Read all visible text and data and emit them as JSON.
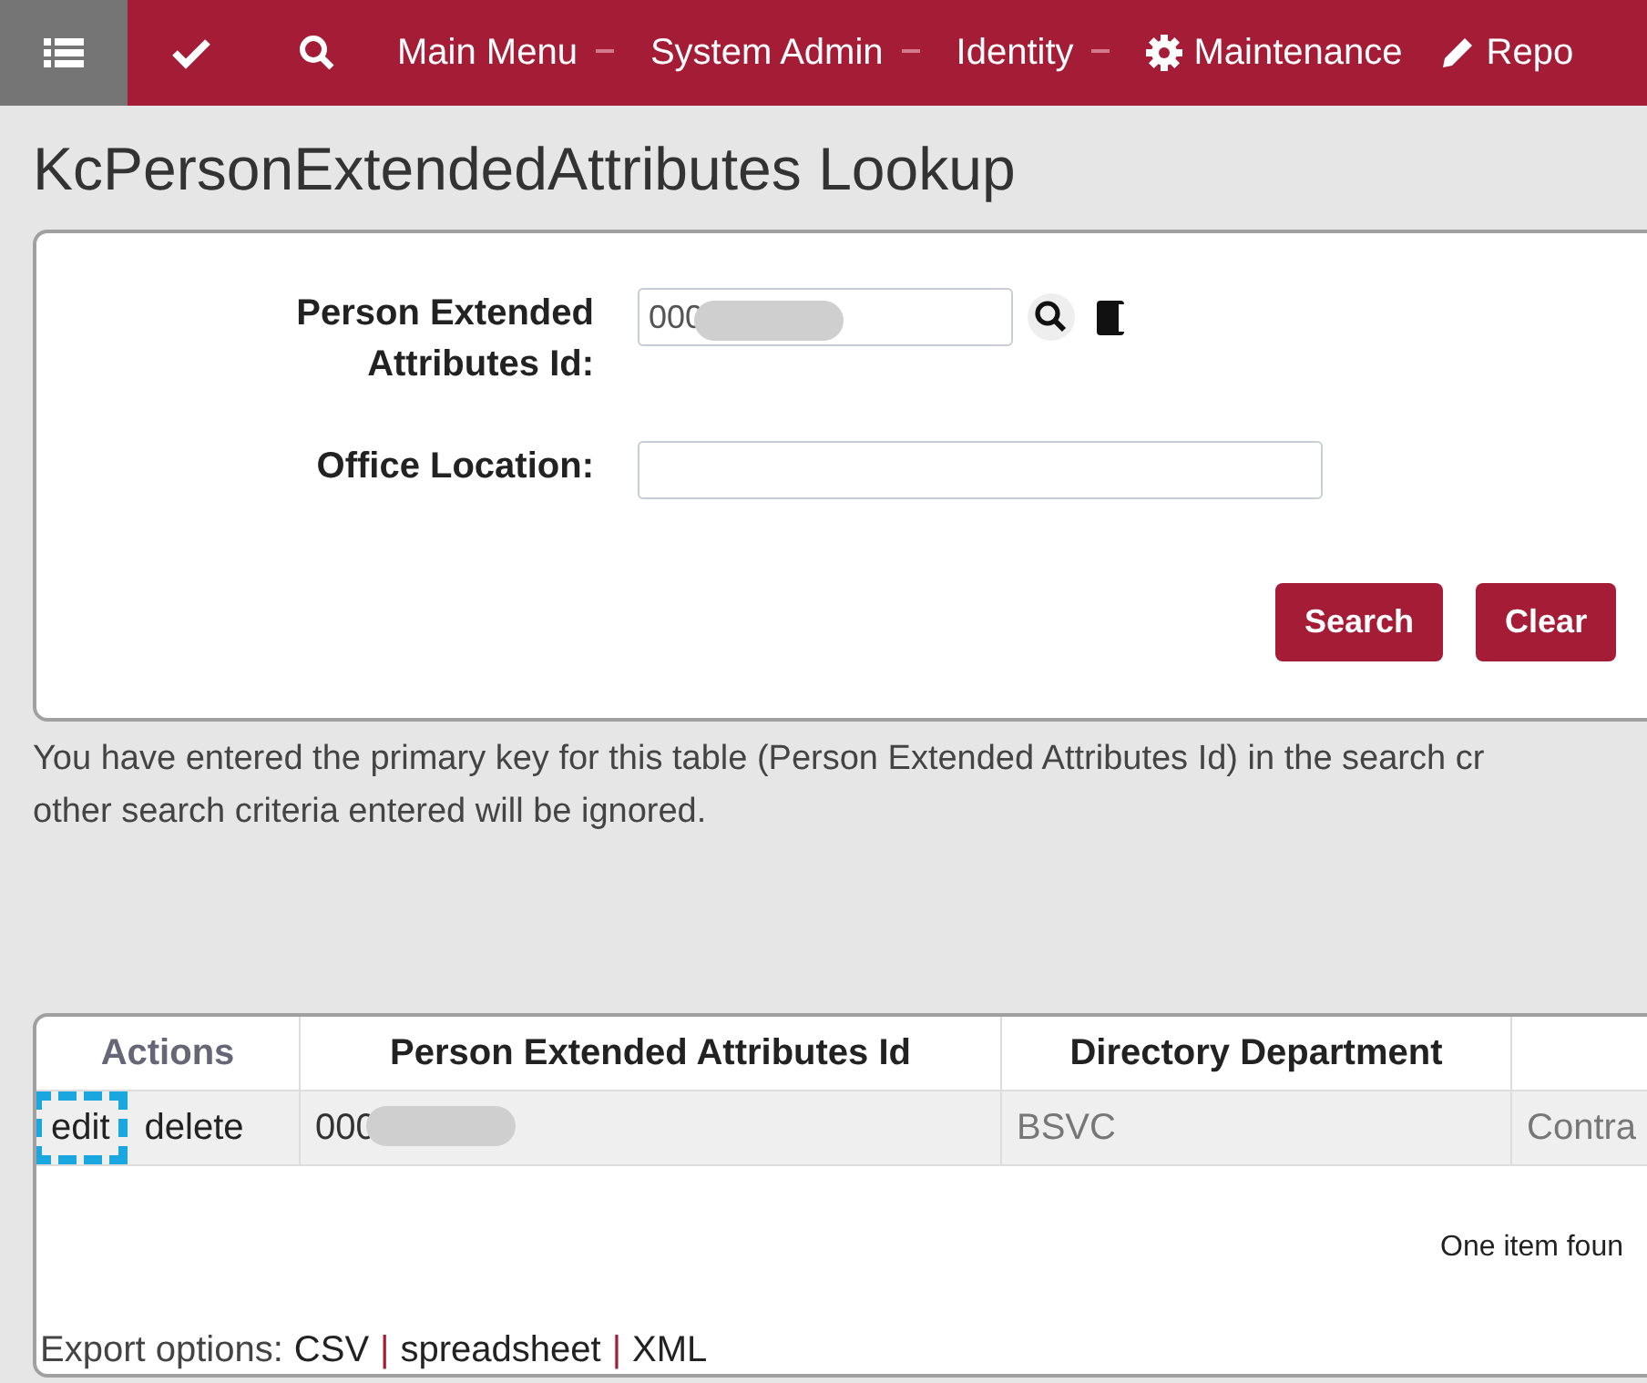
{
  "navbar": {
    "items": [
      {
        "kind": "list",
        "selected": true
      },
      {
        "kind": "check",
        "selected": false
      },
      {
        "kind": "search",
        "selected": false
      },
      {
        "kind": "menu",
        "label": "Main Menu",
        "selected": false
      },
      {
        "kind": "menu",
        "label": "System Admin",
        "selected": false
      },
      {
        "kind": "menu",
        "label": "Identity",
        "selected": false
      },
      {
        "kind": "gear",
        "label": "Maintenance",
        "selected": false
      },
      {
        "kind": "pencil",
        "label": "Repo",
        "selected": false
      }
    ]
  },
  "title": "KcPersonExtendedAttributes Lookup",
  "form": {
    "fields": [
      {
        "label": "Person Extended Attributes Id:",
        "value": "000",
        "redacted": true,
        "lookup": true
      },
      {
        "label": "Office Location:",
        "redacted": false,
        "lookup": false
      }
    ],
    "buttons": [
      "Search",
      "Clear"
    ]
  },
  "message": [
    "You have entered the primary key for this table (Person Extended Attributes Id) in the search cr",
    "other search criteria entered will be ignored."
  ],
  "table": {
    "columns": [
      "Actions",
      "Person Extended Attributes Id",
      "Directory Department"
    ],
    "rows": [
      {
        "actions": [
          {
            "label": "edit",
            "highlighted": true
          },
          {
            "label": "delete",
            "highlighted": false
          }
        ],
        "id": "000",
        "redacted": true,
        "department": "BSVC",
        "column_4": "Contra"
      }
    ],
    "count": "One item foun",
    "export": {
      "label": "Export options:",
      "links": [
        "CSV",
        "spreadsheet",
        "XML"
      ],
      "separator": "|"
    }
  }
}
